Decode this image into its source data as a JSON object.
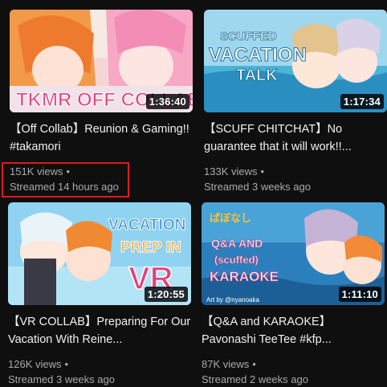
{
  "videos": [
    {
      "title": "【Off Collab】Reunion & Gaming!! #takamori",
      "duration": "1:36:40",
      "views": "151K views",
      "streamed": "Streamed 14 hours ago",
      "thumb_text": "TKMR OFF COLLAB"
    },
    {
      "title": "【SCUFF CHITCHAT】No guarantee that it will work!!...",
      "duration": "1:17:34",
      "views": "133K views",
      "streamed": "Streamed 3 weeks ago",
      "thumb_text_top": "SCUFFED",
      "thumb_text_mid": "VACATION",
      "thumb_text_bottom": "TALK"
    },
    {
      "title": "【VR COLLAB】Preparing For Our Vacation With Reine...",
      "duration": "1:20:55",
      "views": "126K views",
      "streamed": "Streamed 3 weeks ago",
      "thumb_text_top": "VACATION",
      "thumb_text_mid": "PREP IN",
      "thumb_text_bottom": "VR"
    },
    {
      "title": "【Q&A and KARAOKE】Pavonashi TeeTee #kfp...",
      "duration": "1:11:10",
      "views": "87K views",
      "streamed": "Streamed 2 weeks ago",
      "thumb_text_top": "Q&A AND",
      "thumb_text_mid": "(scuffed)",
      "thumb_text_bottom": "KARAOKE",
      "thumb_credit": "Art by @nyanoaka"
    }
  ],
  "separator": "•",
  "colors": {
    "background": "#0f0f0f",
    "title_text": "#f1f1f1",
    "meta_text": "#aaaaaa",
    "highlight": "#e3171b"
  }
}
